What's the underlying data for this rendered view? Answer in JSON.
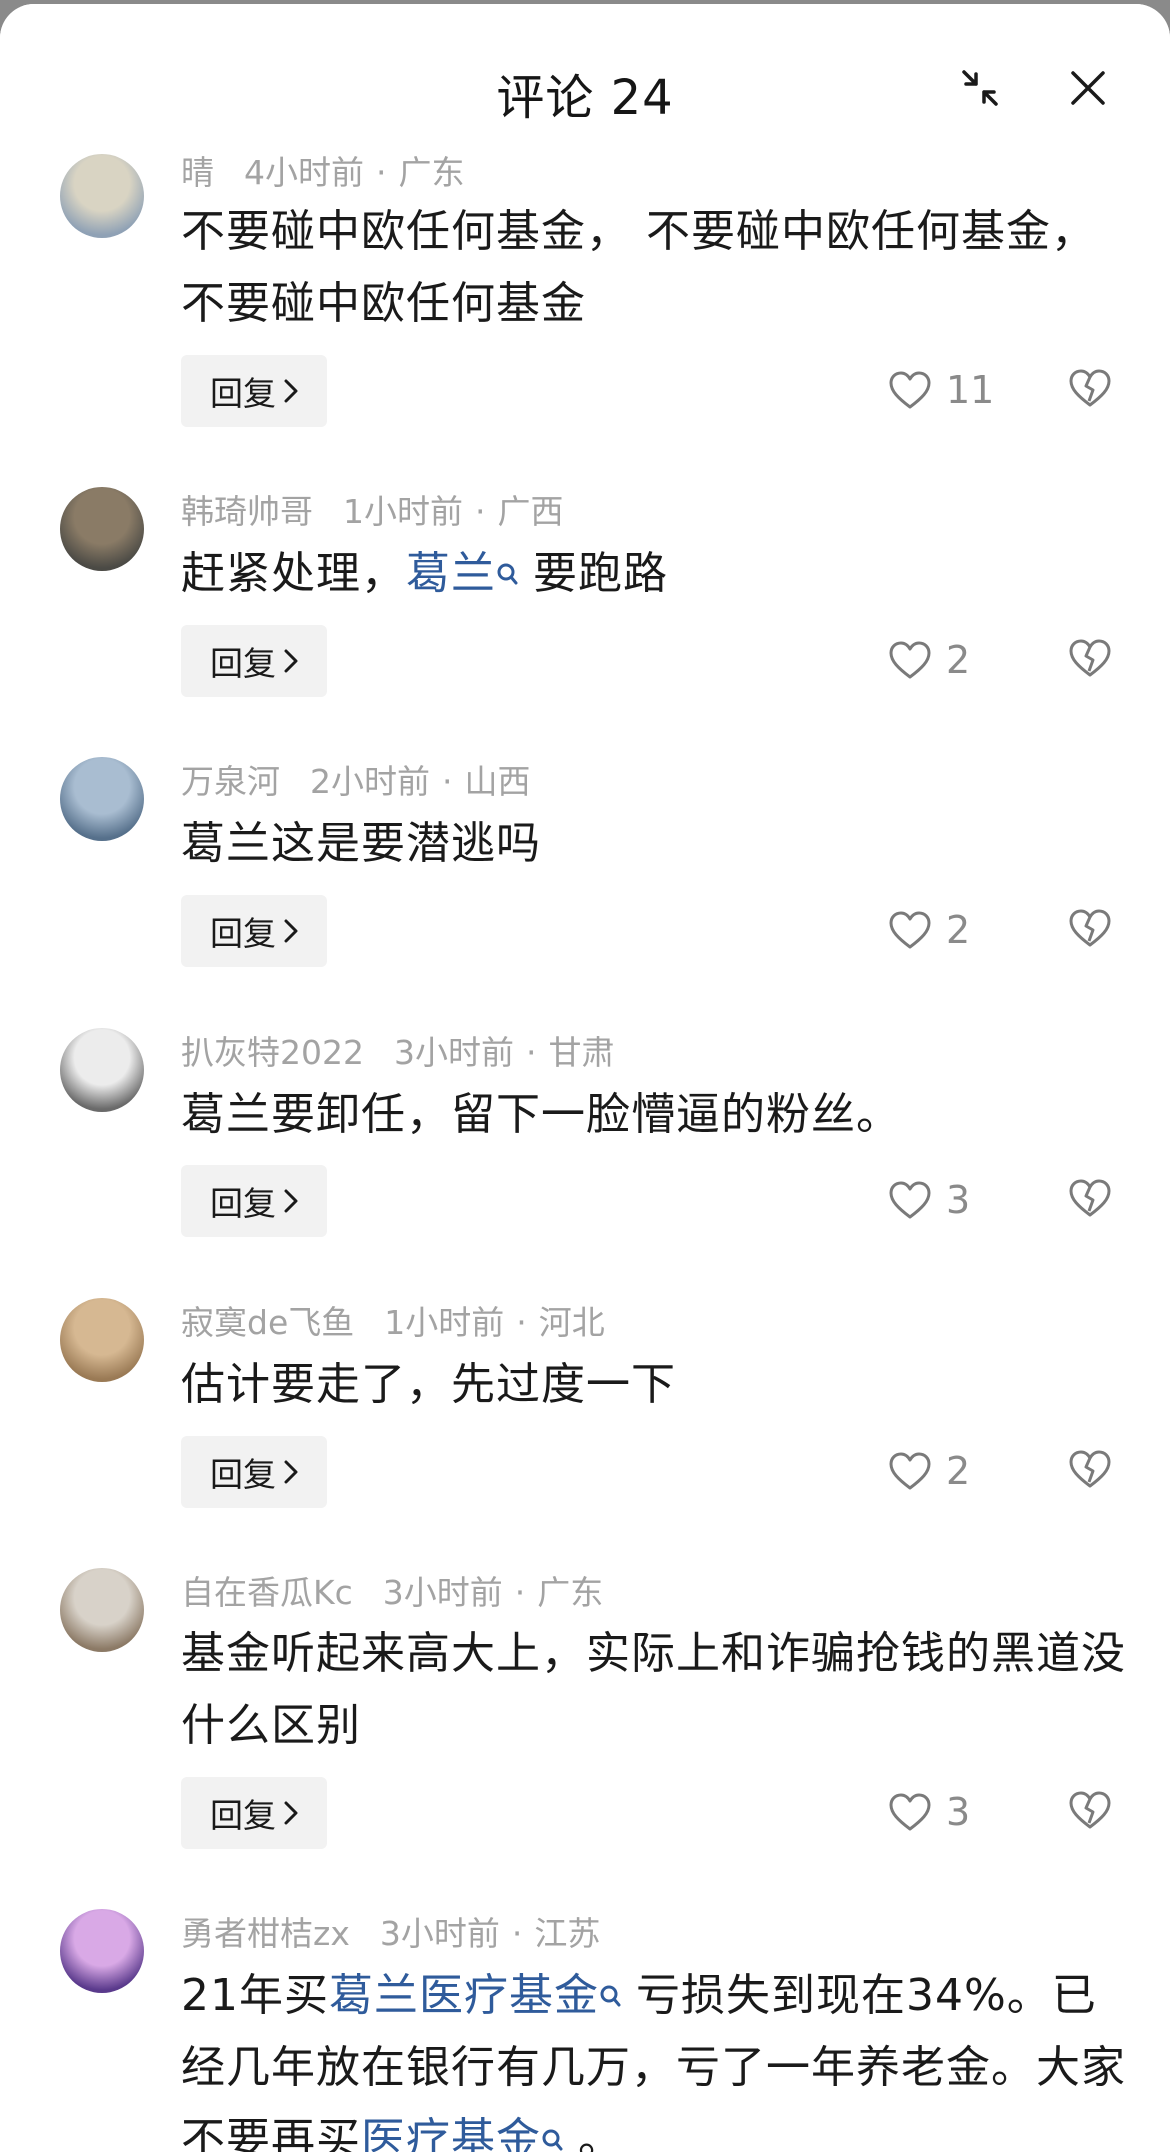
{
  "header": {
    "title": "评论 24"
  },
  "reply_label": "回复",
  "comments": [
    {
      "user": "晴",
      "time": "4小时前",
      "region": "广东",
      "text_parts": [
        {
          "t": "不要碰中欧任何基金， 不要碰中欧任何基金， 不要碰中欧任何基金",
          "kw": false
        }
      ],
      "likes": "11",
      "avatar_colors": [
        "#d9d4c3",
        "#8fa1b5"
      ]
    },
    {
      "user": "韩琦帅哥",
      "time": "1小时前",
      "region": "广西",
      "text_parts": [
        {
          "t": "赶紧处理，",
          "kw": false
        },
        {
          "t": "葛兰",
          "kw": true
        },
        {
          "t": " 要跑路",
          "kw": false
        }
      ],
      "likes": "2",
      "avatar_colors": [
        "#8a7b66",
        "#4b4a45"
      ]
    },
    {
      "user": "万泉河",
      "time": "2小时前",
      "region": "山西",
      "text_parts": [
        {
          "t": "葛兰这是要潜逃吗",
          "kw": false
        }
      ],
      "likes": "2",
      "avatar_colors": [
        "#a9bdd1",
        "#56708b"
      ]
    },
    {
      "user": "扒灰特2022",
      "time": "3小时前",
      "region": "甘肃",
      "text_parts": [
        {
          "t": "葛兰要卸任，留下一脸懵逼的粉丝。",
          "kw": false
        }
      ],
      "likes": "3",
      "avatar_colors": [
        "#ececec",
        "#6a6a6a"
      ]
    },
    {
      "user": "寂寞de飞鱼",
      "time": "1小时前",
      "region": "河北",
      "text_parts": [
        {
          "t": "估计要走了，先过度一下",
          "kw": false
        }
      ],
      "likes": "2",
      "avatar_colors": [
        "#d6b892",
        "#9a7a55"
      ]
    },
    {
      "user": "自在香瓜Kc",
      "time": "3小时前",
      "region": "广东",
      "text_parts": [
        {
          "t": "基金听起来高大上，实际上和诈骗抢钱的黑道没什么区别",
          "kw": false
        }
      ],
      "likes": "3",
      "avatar_colors": [
        "#d8d2c9",
        "#8c7a66"
      ]
    },
    {
      "user": "勇者柑桔zx",
      "time": "3小时前",
      "region": "江苏",
      "text_parts": [
        {
          "t": "21年买",
          "kw": false
        },
        {
          "t": "葛兰医疗基金",
          "kw": true
        },
        {
          "t": " 亏损失到现在34%。已经几年放在银行有几万，亏了一年养老金。大家不要再买",
          "kw": false
        },
        {
          "t": "医疗基金",
          "kw": true
        },
        {
          "t": " 。",
          "kw": false
        }
      ],
      "likes": "",
      "avatar_colors": [
        "#d9a9e6",
        "#5a3a8c"
      ]
    }
  ]
}
